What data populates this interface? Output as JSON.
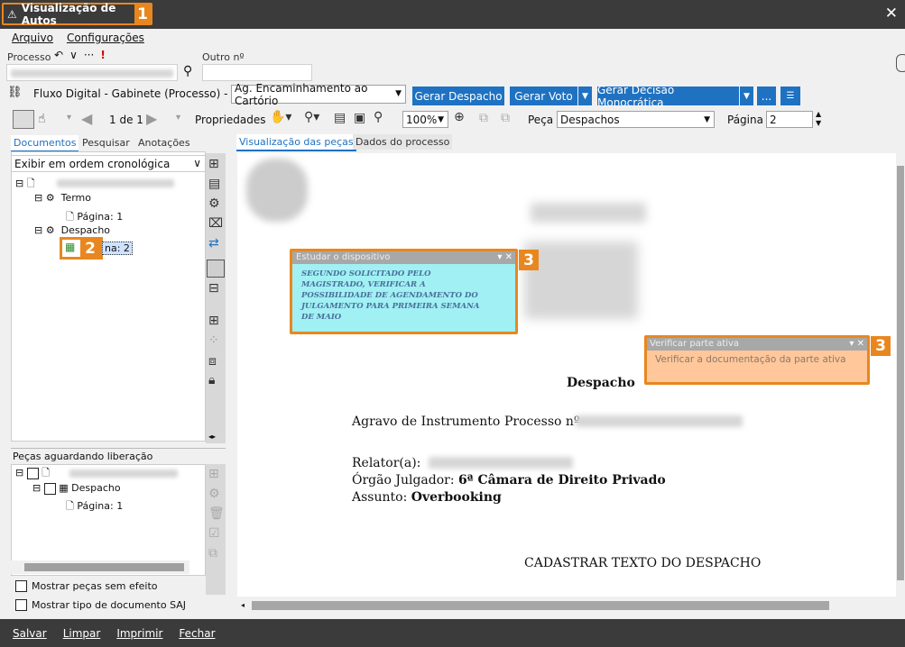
{
  "window": {
    "title": "Visualização de Autos",
    "badge": "1"
  },
  "menu": [
    "Arquivo",
    "Configurações"
  ],
  "process": {
    "label": "Processo",
    "outro_label": "Outro nº",
    "outro_value": ""
  },
  "flow": {
    "text": "Fluxo Digital - Gabinete (Processo) - Fila:",
    "fila_value": "Ag. Encaminhamento ao Cartório"
  },
  "buttons": {
    "gerar_despacho": "Gerar Despacho",
    "gerar_voto": "Gerar Voto",
    "gerar_decisao": "Gerar Decisão Monocrática",
    "more": "..."
  },
  "toolbar": {
    "page_count": "1 de 1",
    "propriedades": "Propriedades",
    "zoom": "100%",
    "peca_label": "Peça",
    "peca_value": "Despachos",
    "pagina_label": "Página",
    "pagina_value": "2"
  },
  "left_tabs": [
    "Documentos",
    "Pesquisar",
    "Anotações"
  ],
  "order_select": "Exibir em ordem cronológica",
  "tree": {
    "termo": "Termo",
    "pagina1": "Página: 1",
    "despacho": "Despacho",
    "pagina2": "na: 2",
    "badge": "2"
  },
  "pending": {
    "title": "Peças aguardando liberação",
    "despacho": "Despacho",
    "pagina": "Página: 1"
  },
  "checks": {
    "sem_efeito": "Mostrar peças sem efeito",
    "tipo_doc": "Mostrar tipo de documento SAJ"
  },
  "doc_tabs": [
    "Visualização das peças",
    "Dados do processo"
  ],
  "note1": {
    "title": "Estudar o dispositivo",
    "text": "SEGUNDO SOLICITADO PELO MAGISTRADO, VERIFICAR A POSSIBILIDADE DE AGENDAMENTO DO JULGAMENTO PARA PRIMEIRA SEMANA DE MAIO",
    "badge": "3"
  },
  "note2": {
    "title": "Verificar parte ativa",
    "text": "Verificar a documentação da parte ativa",
    "badge": "3"
  },
  "document": {
    "heading": "Despacho",
    "agravo": "Agravo de Instrumento",
    "processo": "Processo nº",
    "relator": "Relator(a):",
    "orgao_label": "Órgão Julgador:",
    "orgao_value": "6ª Câmara de Direito Privado",
    "assunto_label": "Assunto:",
    "assunto_value": "Overbooking",
    "body": "CADASTRAR TEXTO DO DESPACHO"
  },
  "bottom": [
    "Salvar",
    "Limpar",
    "Imprimir",
    "Fechar"
  ],
  "colors": {
    "accent": "#e8871f",
    "blue": "#1f72c2",
    "note1_bg": "#a0f0f4",
    "note2_bg": "#ffc79a"
  }
}
